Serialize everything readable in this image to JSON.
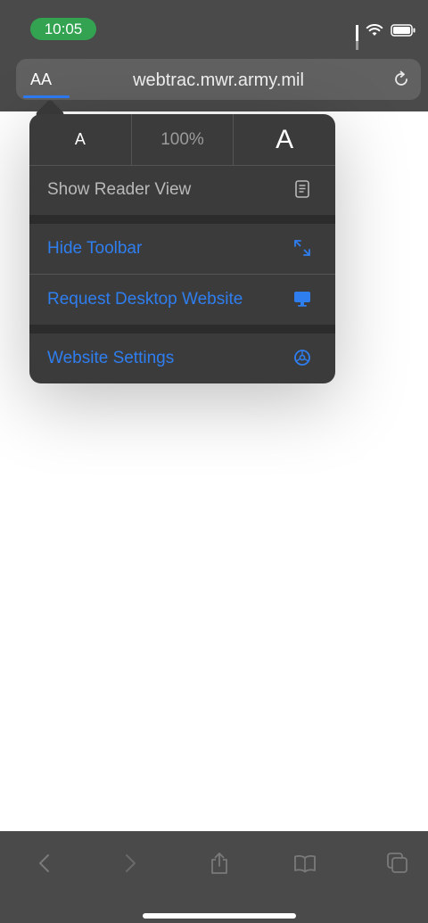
{
  "status_bar": {
    "time": "10:05",
    "icons": [
      "signal-icon",
      "wifi-icon",
      "battery-icon"
    ]
  },
  "address_bar": {
    "text_size_button": "AA",
    "url": "webtrac.mwr.army.mil",
    "reload_icon": "reload-icon"
  },
  "popover": {
    "font_controls": {
      "decrease_label": "A",
      "zoom_level": "100%",
      "increase_label": "A"
    },
    "items": [
      {
        "label": "Show Reader View",
        "icon": "reader-view-icon"
      },
      {
        "label": "Hide Toolbar",
        "icon": "resize-arrows-icon"
      },
      {
        "label": "Request Desktop Website",
        "icon": "desktop-icon"
      },
      {
        "label": "Website Settings",
        "icon": "settings-gear-icon"
      }
    ]
  },
  "toolbar": {
    "icons": [
      "back-icon",
      "forward-icon",
      "share-icon",
      "bookmarks-icon",
      "tabs-icon"
    ]
  },
  "colors": {
    "accent": "#2f7ef0",
    "time_pill": "#33a352",
    "bar_background": "#4a4a4a",
    "popover_background": "#3b3b3b"
  }
}
